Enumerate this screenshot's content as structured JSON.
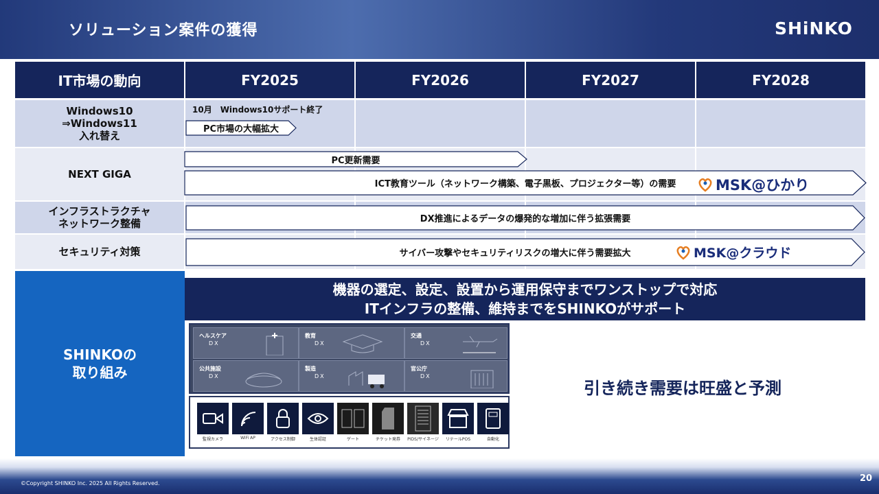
{
  "header": {
    "title": "ソリューション案件の獲得",
    "logo": "SHiNKO"
  },
  "table": {
    "columns": [
      "IT市場の動向",
      "FY2025",
      "FY2026",
      "FY2027",
      "FY2028"
    ],
    "rows": [
      {
        "label": "Windows10\n⇒Windows11\n入れ替え"
      },
      {
        "label": "NEXT GIGA"
      },
      {
        "label": "インフラストラクチャ\nネットワーク整備"
      },
      {
        "label": "セキュリティ対策"
      }
    ],
    "note": "10月　Windows10サポート終了",
    "arrows": {
      "pc_market": "PC市場の大幅拡大",
      "pc_renewal": "PC更新需要",
      "ict": "ICT教育ツール（ネットワーク構築、電子黒板、プロジェクター等）の需要",
      "dx": "DX推進によるデータの爆発的な増加に伴う拡張需要",
      "cyber": "サイバー攻撃やセキュリティリスクの増大に伴う需要拡大"
    },
    "msk_hikari": "MSK@ひかり",
    "msk_cloud": "MSK@クラウド"
  },
  "shinko": {
    "side_label": "SHINKOの\n取り組み",
    "banner_line1": "機器の選定、設定、設置から運用保守までワンストップで対応",
    "banner_line2": "ITインフラの整備、維持までをSHINKOがサポート",
    "tiles": [
      {
        "name": "ヘルスケア",
        "sub": "DX"
      },
      {
        "name": "教育",
        "sub": "DX"
      },
      {
        "name": "交通",
        "sub": "DX"
      },
      {
        "name": "公共施設",
        "sub": "DX"
      },
      {
        "name": "製造",
        "sub": "DX"
      },
      {
        "name": "官公庁",
        "sub": "DX"
      }
    ],
    "devices": [
      "監視カメラ",
      "WiFi AP",
      "アクセス制御",
      "生体認証",
      "ゲート",
      "チケット発券",
      "PIDS/サイネージ",
      "リテールPOS",
      "自動化"
    ],
    "forecast": "引き続き需要は旺盛と予測"
  },
  "footer": {
    "copyright": "©Copyright SHINKO Inc. 2025 All Rights Reserved.",
    "page": "20"
  },
  "colors": {
    "navy": "#15255b",
    "blue": "#1565c0",
    "light": "#cfd6ea"
  }
}
